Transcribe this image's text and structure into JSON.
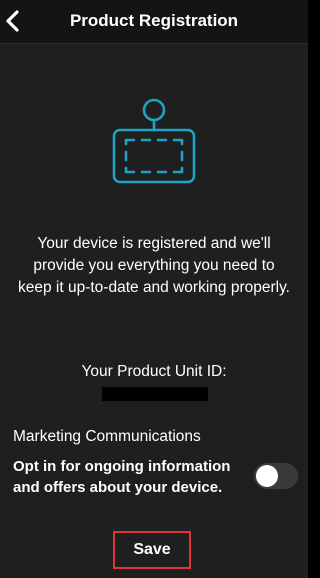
{
  "header": {
    "title": "Product Registration",
    "back_icon": "chevron-left-icon"
  },
  "illustration": {
    "icon": "device-tag-icon",
    "color": "#1fa3c4"
  },
  "content": {
    "message": "Your device is registered and we'll provide you everything you need to keep it up-to-date and working properly.",
    "unit_id_label": "Your Product Unit ID:",
    "unit_id_value": "■■■■■■■■"
  },
  "marketing": {
    "heading": "Marketing Communications",
    "optin_text": "Opt in for ongoing information and offers about your device.",
    "toggle_on": false
  },
  "actions": {
    "save_label": "Save",
    "highlight_color": "#e0333a"
  }
}
